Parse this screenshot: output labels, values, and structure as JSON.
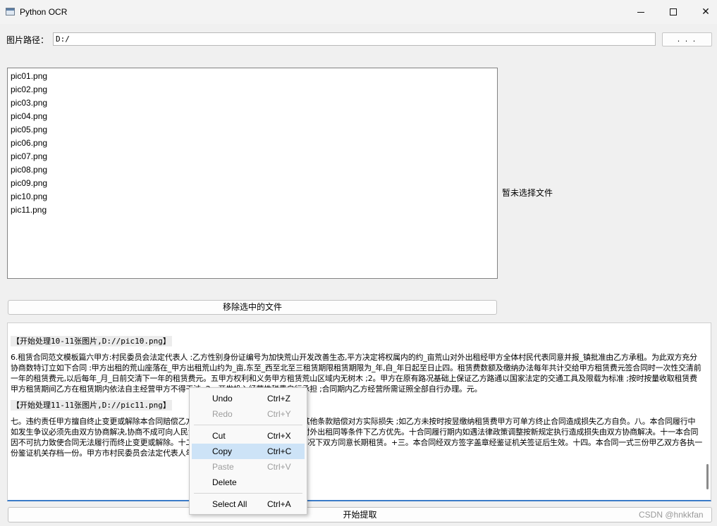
{
  "window": {
    "title": "Python OCR"
  },
  "path": {
    "label": "图片路径：",
    "value": "D:/",
    "browse_label": ". . ."
  },
  "files": [
    "pic01.png",
    "pic02.png",
    "pic03.png",
    "pic04.png",
    "pic05.png",
    "pic06.png",
    "pic07.png",
    "pic08.png",
    "pic09.png",
    "pic10.png",
    "pic11.png"
  ],
  "status": "暂未选择文件",
  "remove_button": "移除选中的文件",
  "output": {
    "header1": "【开始处理10-11张图片,D://pic10.png】",
    "text1": "6.租赁合同范文模板篇六甲方:村民委员会法定代表人 :乙方性别身份证编号为加快荒山开发改善生态,平方决定将权属内的约_亩荒山对外出租经甲方全体村民代表同意并报_镇批准由乙方承租。为此双方充分协商数特订立如下合同 :甲方出租的荒山座落在_甲方出租荒山约为_亩,东至_西至北至三租赁期限租赁期限为_年,自_年日起至日止四。租赁费数额及缴纳办法每年共计交给甲方租赁费元签合同时一次性交清前一年的租赁费元,以后每年_月_日前交清下一年的租赁费元。五甲方权利和义务甲方租赁荒山区域内无树木 ;2。甲方在原有路况基础上保证乙方路通以国家法定的交通工具及限载为标准 ;按时按量收取租赁费甲方租赁期间乙方在租赁期内依法自主经营甲方不得干涉 ;2。开发投入经营性税费自行承担 ;合同期内乙方经营所需证照全部自行办理。元。",
    "header2": "【开始处理11-11张图片,D://pic11.png】",
    "text2": "七。违约责任甲方擅自终止变更或解除本合同赔偿乙方实际损失乙方违反本合同约定的,其他条款赔偿对方实际损失 ;如乙方未按时按昱缴纳租赁费甲方可单方终止合同造成损失乙方自负。八。本合同履行中如发生争议必须先由双方协商解决,协商不成可向人民法院。九。合同到期后如甲方继续对外出租同等条件下乙方优先。十合同履行期内如遇法律政策调整按新规定执行造成损失由双方协商解决。十一本合同因不可抗力致使合同无法履行而终止变更或解除。十二其他约定事项在国家政策允许的情况下双方同意长期租赁。+三。本合同经双方签字盖章经鉴证机关签证后生效。十四。本合同一式三份甲乙双方各执一份鉴证机关存档一份。甲方市村民委员会法定代表人年乙方:鉴证机关年"
  },
  "context_menu": {
    "items": [
      {
        "label": "Undo",
        "shortcut": "Ctrl+Z"
      },
      {
        "label": "Redo",
        "shortcut": "Ctrl+Y"
      },
      {
        "label": "Cut",
        "shortcut": "Ctrl+X"
      },
      {
        "label": "Copy",
        "shortcut": "Ctrl+C"
      },
      {
        "label": "Paste",
        "shortcut": "Ctrl+V"
      },
      {
        "label": "Delete",
        "shortcut": ""
      },
      {
        "label": "Select All",
        "shortcut": "Ctrl+A"
      }
    ]
  },
  "start_button": "开始提取",
  "watermark": "CSDN @hnkkfan"
}
